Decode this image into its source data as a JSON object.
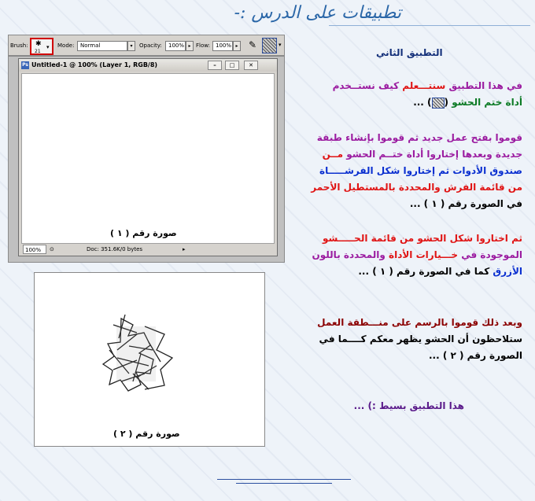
{
  "page_title": "تطبيقات على الدرس :-",
  "options_bar": {
    "brush_label": "Brush:",
    "brush_size": "21",
    "mode_label": "Mode:",
    "mode_value": "Normal",
    "opacity_label": "Opacity:",
    "opacity_value": "100%",
    "flow_label": "Flow:",
    "flow_value": "100%"
  },
  "document": {
    "title": "Untitled-1 @ 100% (Layer 1, RGB/8)",
    "zoom": "100%",
    "doc_info": "Doc: 351.6K/0 bytes",
    "caption": "صورة رقم ( ١ )"
  },
  "image2": {
    "caption": "صورة رقم ( ٢ )"
  },
  "content": {
    "heading": "التطبيق الثاني",
    "p1": {
      "a": "في هذا التطبيق ",
      "b": "سنتـــعلم",
      "c": " كيف نستــخدم",
      "d": "أداة ختم الحشو",
      "e": " (",
      "f": ") ..."
    },
    "p2": {
      "l1a": "قوموا بفتح عمل جديد ثم قوموا بإنشاء طبقة",
      "l2a": "جديدة وبعدها إختاروا أداة ختــم الحشو ",
      "l2b": "مــن",
      "l3a": "صندوق الأدوات ثم إختاروا شكل الفرشـــــاة",
      "l4a": "من قائمة الفرش والمحددة بالمستطيل الأحمر",
      "l5a": "في الصورة رقم ( ١ ) ..."
    },
    "p3": {
      "l1": "ثم اختاروا شكل الحشو من قائمة الحـــــشو",
      "l2a": "الموجودة في ",
      "l2b": "خـــيارات الأداة",
      "l2c": " والمحددة باللون",
      "l3a": "الأزرق",
      "l3b": " كما في الصورة رقم ( ١ ) ..."
    },
    "p4": {
      "l1": "وبعد ذلك قوموا بالرسم على منـــطقة العمل",
      "l2": "ستلاحظون أن الحشو يظهر معكم كــــما في",
      "l3": "الصورة رقم ( ٢ ) ..."
    },
    "closing": "هذا التطبيق بسيط :) ..."
  },
  "icons": {
    "brush": "brush-tip-icon",
    "airbrush": "airbrush-icon",
    "pattern": "pattern-swatch-icon",
    "doc": "photoshop-doc-icon"
  },
  "colors": {
    "title": "#2b67a8",
    "red_highlight": "#d00000",
    "blue_highlight": "#2d4e9e"
  }
}
